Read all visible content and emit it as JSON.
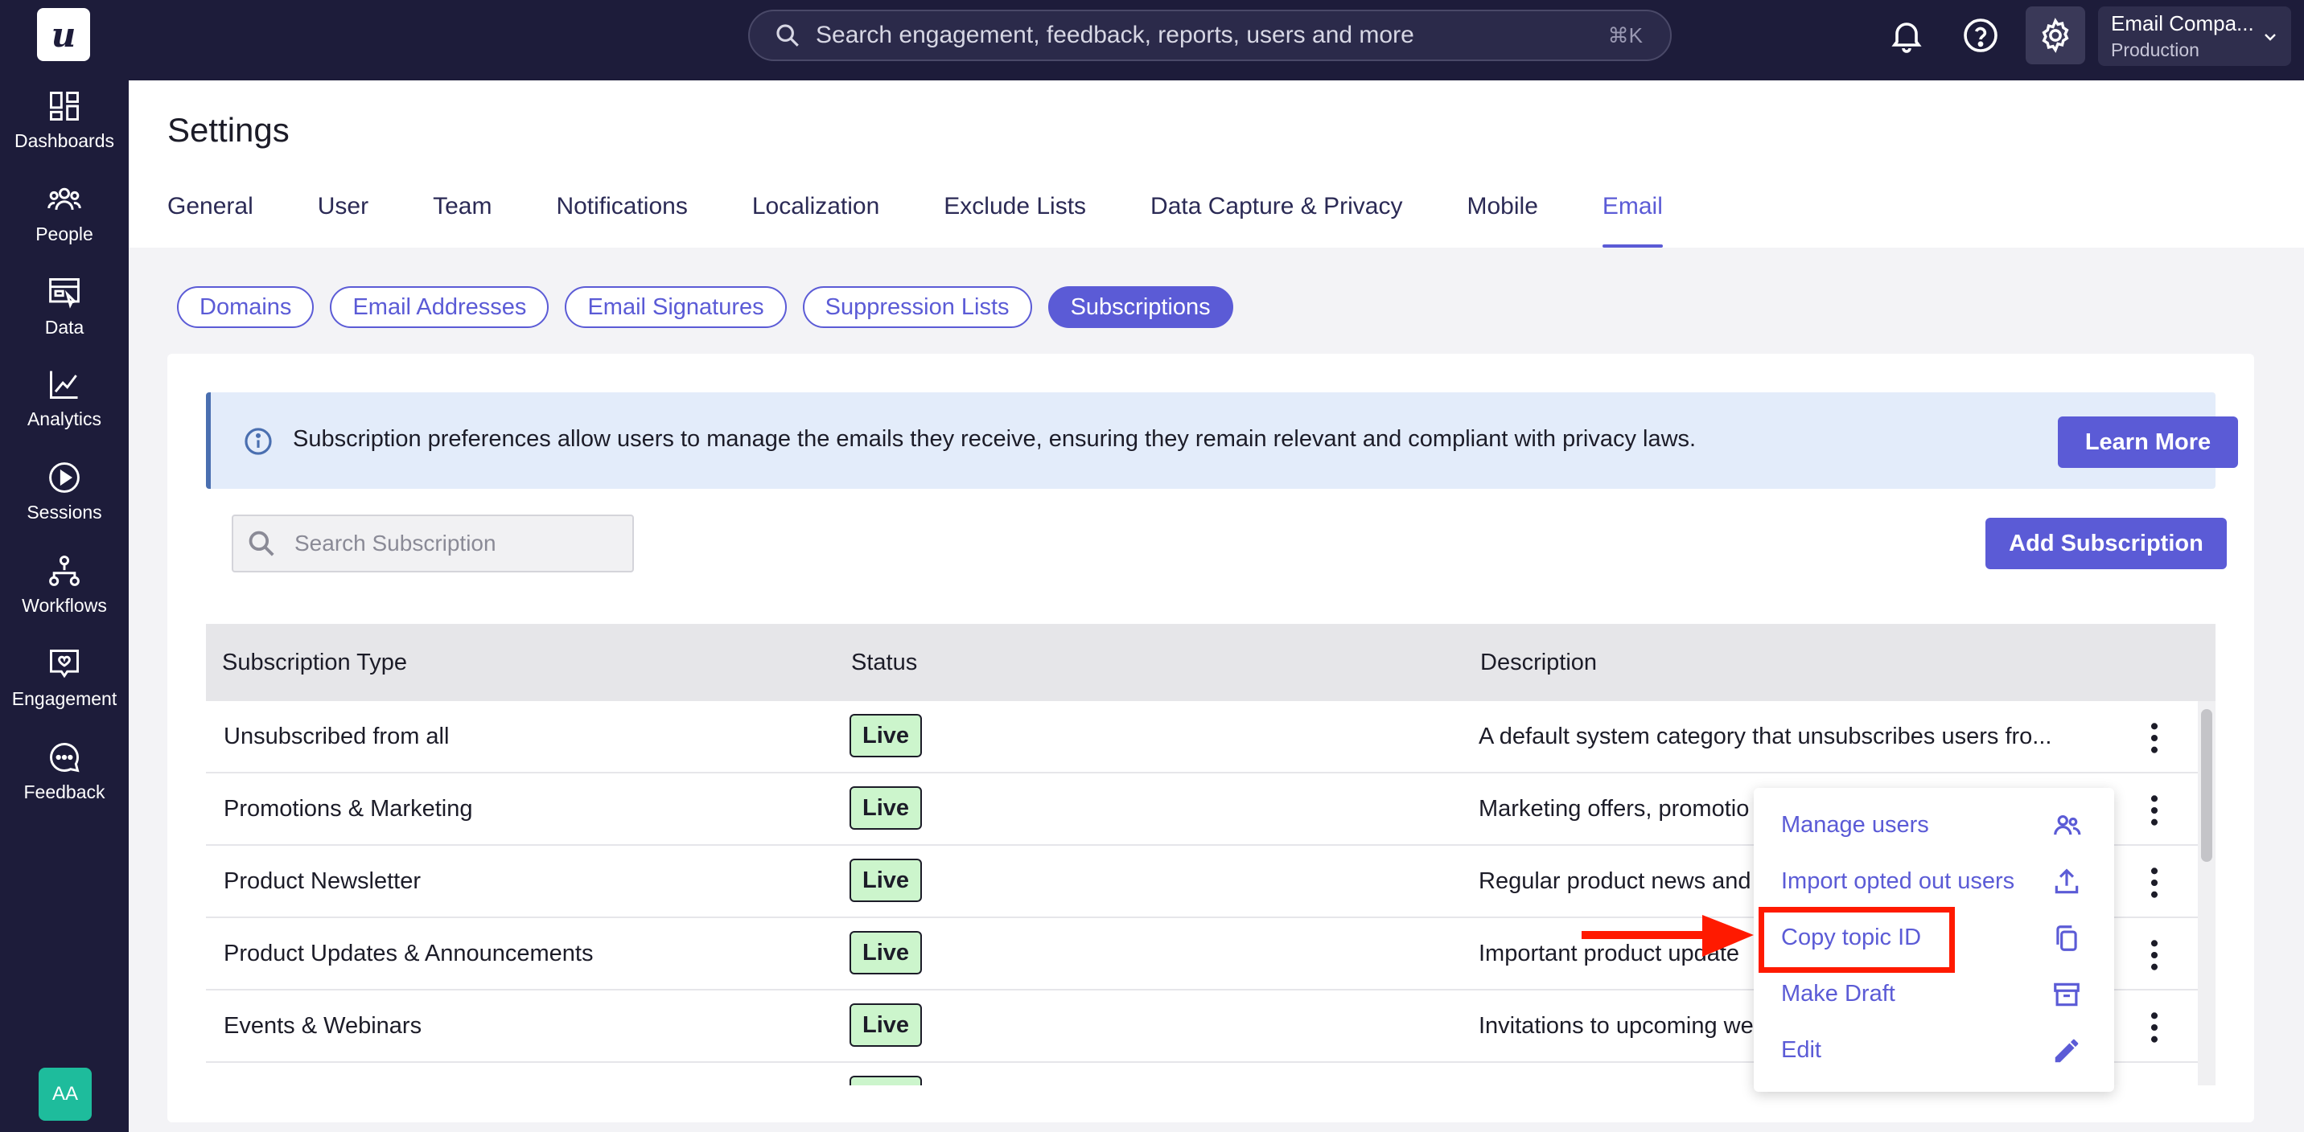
{
  "topbar": {
    "logo_letter": "u",
    "search_placeholder": "Search engagement, feedback, reports, users and more",
    "search_shortcut": "⌘K",
    "account_name": "Email Compa...",
    "account_env": "Production"
  },
  "sidebar": {
    "items": [
      {
        "label": "Dashboards",
        "icon": "dashboard-icon"
      },
      {
        "label": "People",
        "icon": "people-icon"
      },
      {
        "label": "Data",
        "icon": "data-icon"
      },
      {
        "label": "Analytics",
        "icon": "analytics-icon"
      },
      {
        "label": "Sessions",
        "icon": "sessions-icon"
      },
      {
        "label": "Workflows",
        "icon": "workflows-icon"
      },
      {
        "label": "Engagement",
        "icon": "engagement-icon"
      },
      {
        "label": "Feedback",
        "icon": "feedback-icon"
      }
    ],
    "avatar": "AA"
  },
  "page": {
    "title": "Settings",
    "tabs": [
      "General",
      "User",
      "Team",
      "Notifications",
      "Localization",
      "Exclude Lists",
      "Data Capture & Privacy",
      "Mobile",
      "Email"
    ],
    "active_tab": "Email",
    "sub_tabs": [
      "Domains",
      "Email Addresses",
      "Email Signatures",
      "Suppression Lists",
      "Subscriptions"
    ],
    "active_sub_tab": "Subscriptions"
  },
  "info": {
    "message": "Subscription preferences allow users to manage the emails they receive, ensuring they remain relevant and compliant with privacy laws.",
    "learn_more": "Learn More"
  },
  "toolbar": {
    "search_placeholder": "Search Subscription",
    "add_label": "Add Subscription"
  },
  "table": {
    "headers": [
      "Subscription Type",
      "Status",
      "Description"
    ],
    "rows": [
      {
        "type": "Unsubscribed from all",
        "status": "Live",
        "desc": "A default system category that unsubscribes users fro..."
      },
      {
        "type": "Promotions & Marketing",
        "status": "Live",
        "desc": "Marketing offers, promotio"
      },
      {
        "type": "Product Newsletter",
        "status": "Live",
        "desc": "Regular product news and"
      },
      {
        "type": "Product Updates & Announcements",
        "status": "Live",
        "desc": "Important product update"
      },
      {
        "type": "Events & Webinars",
        "status": "Live",
        "desc": "Invitations to upcoming we"
      }
    ]
  },
  "menu": {
    "items": [
      {
        "label": "Manage users",
        "icon": "users-icon"
      },
      {
        "label": "Import opted out users",
        "icon": "upload-icon"
      },
      {
        "label": "Copy topic ID",
        "icon": "copy-icon"
      },
      {
        "label": "Make Draft",
        "icon": "archive-icon"
      },
      {
        "label": "Edit",
        "icon": "pencil-icon"
      }
    ]
  },
  "colors": {
    "nav_bg": "#1d1c3a",
    "accent": "#5b5bd6",
    "live_badge": "#ccf5cc",
    "annotation_red": "#ff1a00"
  }
}
